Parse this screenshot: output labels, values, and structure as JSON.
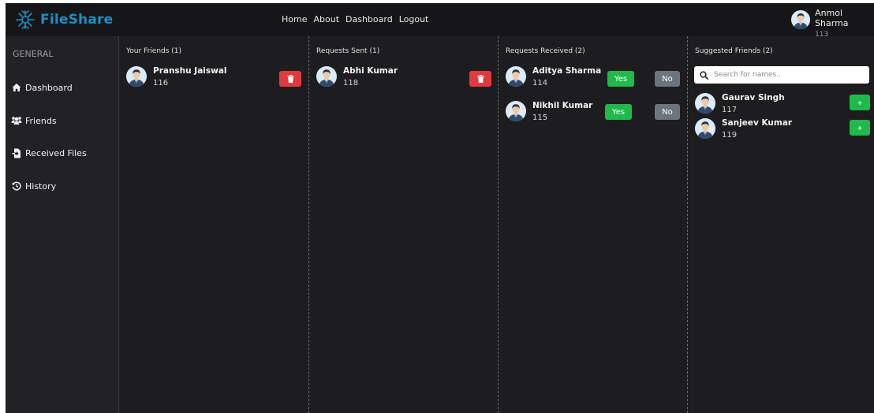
{
  "brand": {
    "name": "FileShare",
    "color": "#1f8ec4"
  },
  "nav": {
    "links": [
      "Home",
      "About",
      "Dashboard",
      "Logout"
    ]
  },
  "current_user": {
    "name": "Anmol Sharma",
    "id": "113"
  },
  "sidebar": {
    "heading": "GENERAL",
    "items": [
      {
        "label": "Dashboard",
        "icon": "home-icon"
      },
      {
        "label": "Friends",
        "icon": "users-icon"
      },
      {
        "label": "Received Files",
        "icon": "file-import-icon"
      },
      {
        "label": "History",
        "icon": "history-icon"
      }
    ]
  },
  "friends": {
    "title": "Your Friends (1)",
    "items": [
      {
        "name": "Pranshu Jaiswal",
        "id": "116"
      }
    ]
  },
  "requests_sent": {
    "title": "Requests Sent (1)",
    "items": [
      {
        "name": "Abhi Kumar",
        "id": "118"
      }
    ]
  },
  "requests_received": {
    "title": "Requests Received (2)",
    "accept_label": "Yes",
    "reject_label": "No",
    "items": [
      {
        "name": "Aditya Sharma",
        "id": "114"
      },
      {
        "name": "Nikhil Kumar",
        "id": "115"
      }
    ]
  },
  "suggested": {
    "title": "Suggested Friends (2)",
    "search_placeholder": "Search for names..",
    "add_label": "+",
    "items": [
      {
        "name": "Gaurav Singh",
        "id": "117"
      },
      {
        "name": "Sanjeev Kumar",
        "id": "119"
      }
    ]
  },
  "colors": {
    "danger": "#e03a3f",
    "success": "#1fba4a",
    "secondary": "#6c757d",
    "background": "#1d1d1f"
  }
}
